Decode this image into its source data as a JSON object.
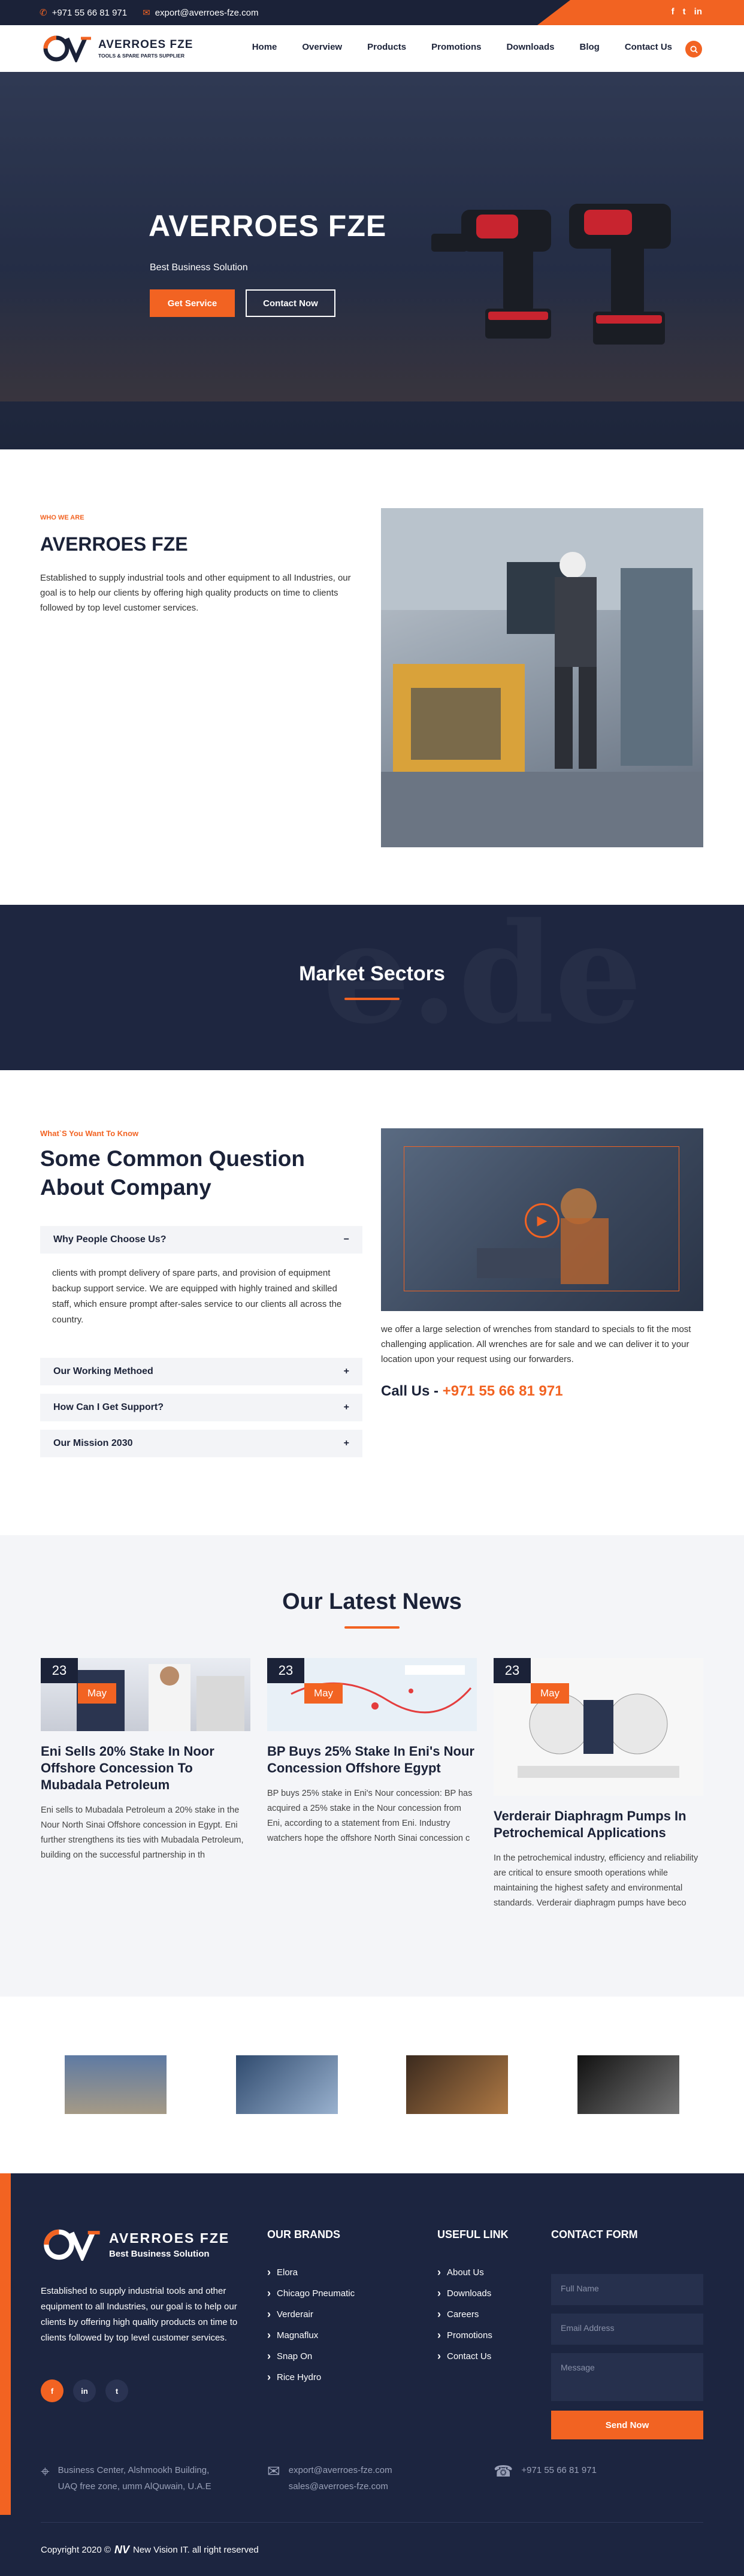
{
  "topbar": {
    "phone": "+971 55 66 81 971",
    "email": "export@averroes-fze.com",
    "social": [
      "f",
      "t",
      "in"
    ]
  },
  "header": {
    "logo_name": "AVERROES FZE",
    "logo_tag": "TOOLS & SPARE PARTS SUPPLIER",
    "nav": [
      "Home",
      "Overview",
      "Products",
      "Promotions",
      "Downloads",
      "Blog",
      "Contact Us"
    ]
  },
  "hero": {
    "title": "AVERROES FZE",
    "subtitle": "Best Business Solution",
    "btn_service": "Get Service",
    "btn_contact": "Contact Now"
  },
  "about": {
    "eyebrow": "WHO WE ARE",
    "title": "AVERROES FZE",
    "text": "Established to supply industrial tools and other equipment to all Industries, our goal is to help our clients by offering high quality products on time to clients followed by top level customer services."
  },
  "market": {
    "title": "Market Sectors"
  },
  "faq": {
    "eyebrow": "What`S You Want To Know",
    "title": "Some Common Question About Company",
    "items": [
      {
        "q": "Why People Choose Us?",
        "open": true
      },
      {
        "q": "Our Working Methoed",
        "open": false
      },
      {
        "q": "How Can I Get Support?",
        "open": false
      },
      {
        "q": "Our Mission 2030",
        "open": false
      }
    ],
    "answer": "clients with prompt delivery of spare parts, and provision of equipment backup support service. We are equipped with highly trained and skilled staff, which ensure prompt after-sales service to our clients all across the country.",
    "right_text": "we offer a large selection of wrenches from standard to specials to fit the most challenging application. All wrenches are for sale and we can deliver it to your location upon your request using our forwarders.",
    "call_label": "Call Us -",
    "call_number": "+971 55 66 81 971"
  },
  "news": {
    "title": "Our Latest News",
    "cards": [
      {
        "day": "23",
        "month": "May",
        "title": "Eni Sells 20% Stake In Noor Offshore Concession To Mubadala Petroleum",
        "text": "Eni sells to Mubadala Petroleum a 20% stake in the Nour North Sinai Offshore concession in Egypt. Eni further strengthens its ties with Mubadala Petroleum, building on the successful partnership in th"
      },
      {
        "day": "23",
        "month": "May",
        "title": "BP Buys 25% Stake In Eni's Nour Concession Offshore Egypt",
        "text": "BP buys 25% stake in Eni's Nour concession: BP has acquired a 25% stake in the Nour concession from Eni, according to a statement from Eni. Industry watchers hope the offshore North Sinai concession c"
      },
      {
        "day": "23",
        "month": "May",
        "title": "Verderair Diaphragm Pumps In Petrochemical Applications",
        "text": "In the petrochemical industry, efficiency and reliability are critical to ensure smooth operations while maintaining the highest safety and environmental standards. Verderair diaphragm pumps have beco"
      }
    ]
  },
  "footer": {
    "logo_name": "AVERROES FZE",
    "logo_tag": "Best Business Solution",
    "about": "Established to supply industrial tools and other equipment to all Industries, our goal is to help our clients by offering high quality products on time to clients followed by top level customer services.",
    "brands_title": "OUR BRANDS",
    "brands": [
      "Elora",
      "Chicago Pneumatic",
      "Verderair",
      "Magnaflux",
      "Snap On",
      "Rice Hydro"
    ],
    "links_title": "USEFUL LINK",
    "links": [
      "About Us",
      "Downloads",
      "Careers",
      "Promotions",
      "Contact Us"
    ],
    "form_title": "CONTACT FORM",
    "form_name": "Full Name",
    "form_email": "Email Address",
    "form_message": "Message",
    "form_send": "Send Now",
    "address_1": "Business Center, Alshmookh Building,",
    "address_2": "UAQ free zone, umm AlQuwain, U.A.E",
    "email_1": "export@averroes-fze.com",
    "email_2": "sales@averroes-fze.com",
    "phone": "+971 55 66 81 971",
    "copyright": "Copyright 2020 ©",
    "credit_logo": "NV",
    "credit": "New Vision IT. all right reserved"
  },
  "colors": {
    "accent": "#f26322",
    "navy": "#1b2238"
  }
}
